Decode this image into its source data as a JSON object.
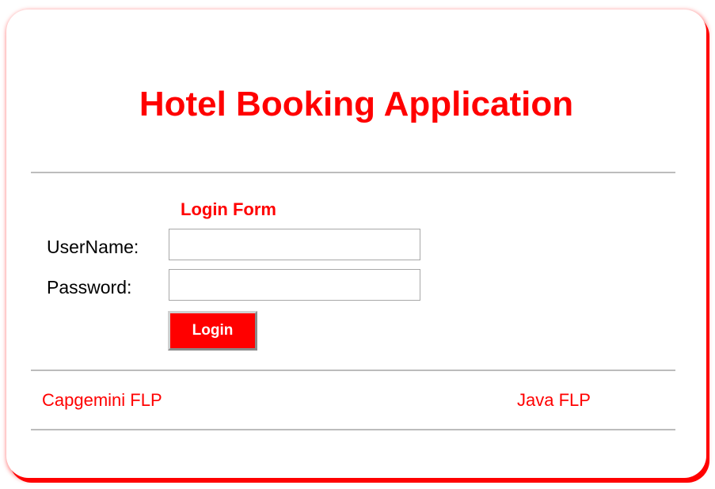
{
  "header": {
    "title": "Hotel Booking Application"
  },
  "form": {
    "title": "Login Form",
    "username_label": "UserName:",
    "password_label": "Password:",
    "username_value": "",
    "password_value": "",
    "login_label": "Login"
  },
  "footer": {
    "left_text": "Capgemini FLP",
    "right_text": "Java FLP"
  },
  "colors": {
    "accent": "#ff0000",
    "divider": "#bcbcbc",
    "text": "#000000"
  }
}
